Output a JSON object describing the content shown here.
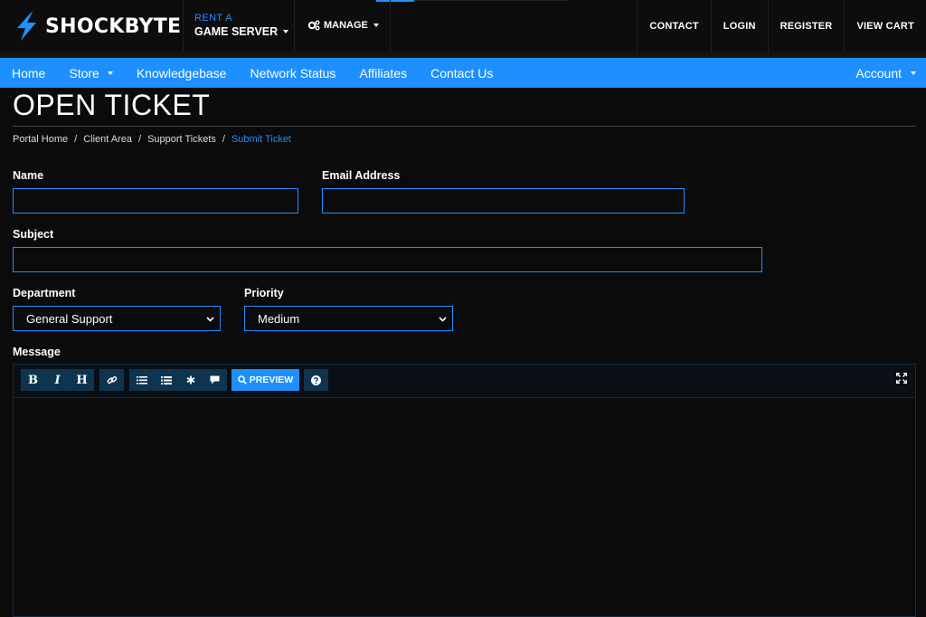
{
  "header": {
    "brand": "SHOCKBYTE",
    "rent_small": "RENT A",
    "rent_big": "GAME SERVER",
    "manage": "MANAGE",
    "links": [
      "CONTACT",
      "LOGIN",
      "REGISTER",
      "VIEW CART"
    ]
  },
  "nav": {
    "items": [
      {
        "label": "Home"
      },
      {
        "label": "Store"
      },
      {
        "label": "Knowledgebase"
      },
      {
        "label": "Network Status"
      },
      {
        "label": "Affiliates"
      },
      {
        "label": "Contact Us"
      }
    ],
    "account": "Account"
  },
  "page": {
    "title": "OPEN TICKET"
  },
  "breadcrumb": [
    "Portal Home",
    "Client Area",
    "Support Tickets",
    "Submit Ticket"
  ],
  "form": {
    "name_label": "Name",
    "name_value": "",
    "email_label": "Email Address",
    "email_value": "",
    "subject_label": "Subject",
    "subject_value": "",
    "department_label": "Department",
    "department_value": "General Support",
    "priority_label": "Priority",
    "priority_value": "Medium",
    "message_label": "Message"
  },
  "editor": {
    "buttons": [
      "B",
      "I",
      "H"
    ],
    "preview_label": "PREVIEW"
  },
  "colors": {
    "accent": "#1e8fff",
    "background": "#0b0b0b",
    "header": "#0d0d0d"
  }
}
